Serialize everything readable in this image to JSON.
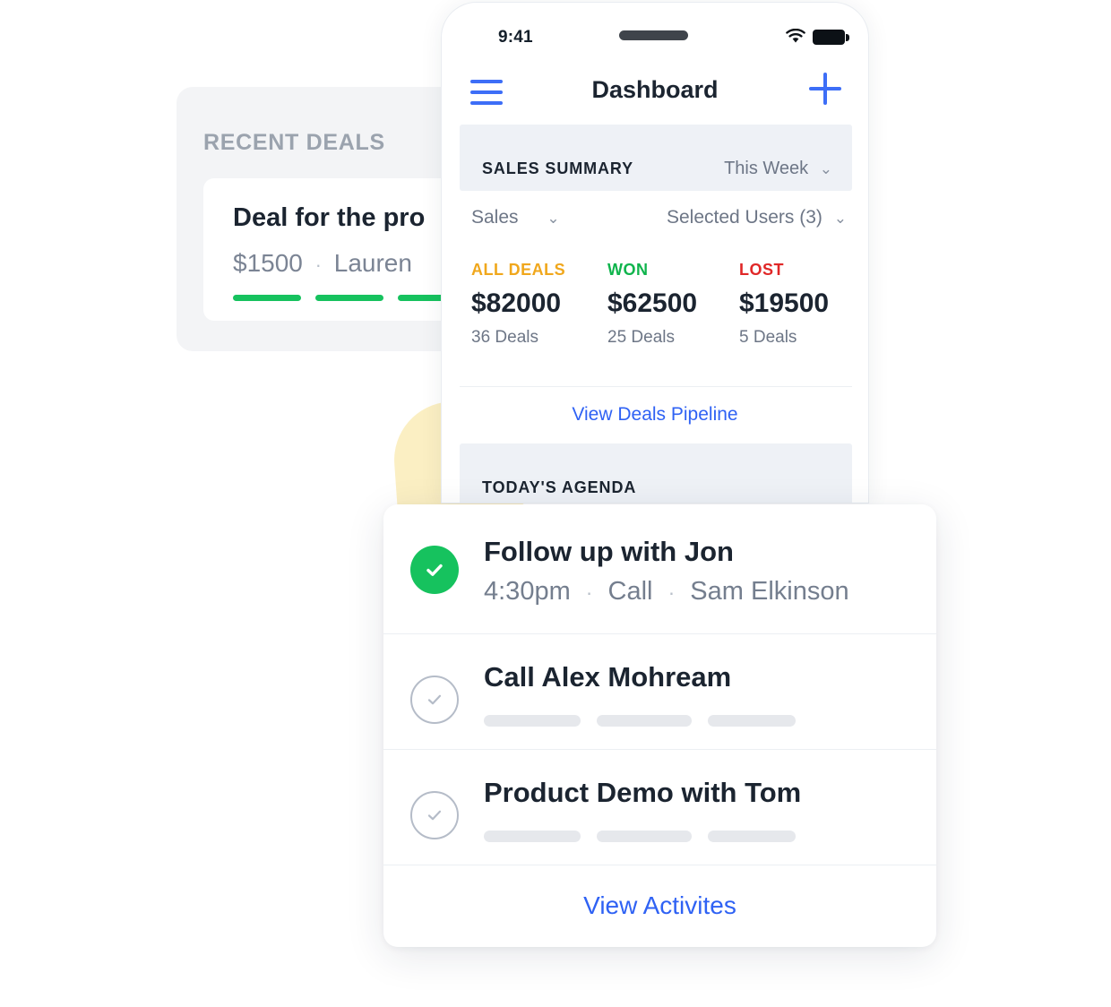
{
  "recent_deals": {
    "section_title": "RECENT DEALS",
    "deal": {
      "title": "Deal for the pro",
      "amount": "$1500",
      "separator": "·",
      "owner": "Lauren",
      "progress_segments": 3,
      "progress_color": "#16c25e"
    }
  },
  "phone": {
    "status_bar": {
      "time": "9:41",
      "wifi_icon": "wifi-icon",
      "battery_icon": "battery-icon"
    },
    "nav": {
      "menu_icon": "hamburger-menu-icon",
      "title": "Dashboard",
      "add_icon": "plus-icon"
    },
    "sales_summary": {
      "header": "SALES SUMMARY",
      "period_filter": "This Week",
      "chevron": "⌄",
      "type_filter": "Sales",
      "users_filter": "Selected Users (3)",
      "metrics": [
        {
          "label": "ALL DEALS",
          "value": "$82000",
          "sub": "36 Deals",
          "color": "#f0a71c"
        },
        {
          "label": "WON",
          "value": "$62500",
          "sub": "25 Deals",
          "color": "#0fb44c"
        },
        {
          "label": "LOST",
          "value": "$19500",
          "sub": "5 Deals",
          "color": "#e02727"
        }
      ],
      "pipeline_link": "View Deals Pipeline"
    },
    "agenda_band": {
      "header": "TODAY'S AGENDA"
    }
  },
  "agenda": {
    "items": [
      {
        "title": "Follow up with Jon",
        "time": "4:30pm",
        "type": "Call",
        "person": "Sam Elkinson",
        "separator": "·",
        "completed": true
      },
      {
        "title": "Call Alex Mohream",
        "completed": false
      },
      {
        "title": "Product Demo with Tom",
        "completed": false
      }
    ],
    "footer_link": "View Activites"
  },
  "colors": {
    "accent_blue": "#2f62f4",
    "green": "#16c25e",
    "panel_gray": "#f3f4f6",
    "band_gray": "#eef1f6",
    "blob_yellow": "#fbefc3"
  }
}
